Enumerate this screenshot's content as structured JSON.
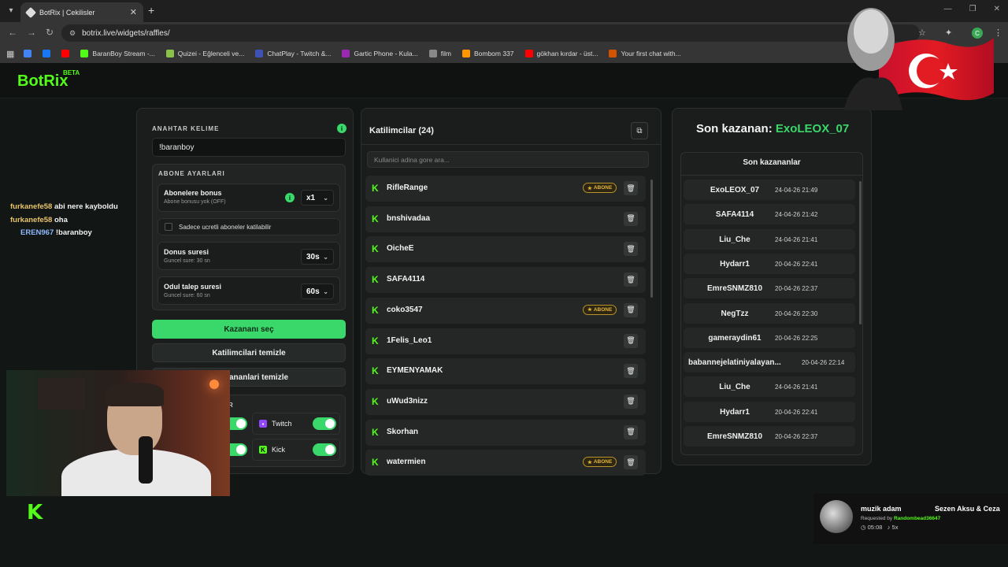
{
  "browser": {
    "tab_title": "BotRix | Cekilisler",
    "url": "botrix.live/widgets/raffles/",
    "bookmarks": [
      {
        "label": "",
        "color": "#4285f4"
      },
      {
        "label": "",
        "color": "#1877f2"
      },
      {
        "label": "",
        "color": "#ff0000"
      },
      {
        "label": "BaranBoy Stream -...",
        "color": "#53fc18"
      },
      {
        "label": "Quizei - Eğlenceli ve...",
        "color": "#8bc34a"
      },
      {
        "label": "ChatPlay - Twitch &...",
        "color": "#3f51b5"
      },
      {
        "label": "Gartic Phone - Kula...",
        "color": "#9c27b0"
      },
      {
        "label": "film",
        "color": "#888888"
      },
      {
        "label": "Bombom 337",
        "color": "#ff9800"
      },
      {
        "label": "gökhan kırdar - üst...",
        "color": "#ff0000"
      },
      {
        "label": "Your first chat with...",
        "color": "#d35400"
      }
    ]
  },
  "app": {
    "logo": "BotRix",
    "logo_tag": "BETA"
  },
  "settings": {
    "keyword_label": "ANAHTAR KELIME",
    "keyword_value": "!baranboy",
    "sub_settings_label": "ABONE AYARLARI",
    "sub_bonus_title": "Abonelere bonus",
    "sub_bonus_sub": "Abone bonusu yok (OFF)",
    "sub_bonus_value": "x1",
    "only_paid_label": "Sadece ucretli aboneler katilabilir",
    "spin_title": "Donus suresi",
    "spin_sub": "Guncel sure: 30 sn",
    "spin_value": "30s",
    "claim_title": "Odul talep suresi",
    "claim_sub": "Guncel sure: 60 sn",
    "claim_value": "60s",
    "pick_winner": "Kazananı seç",
    "clear_participants": "Katilimcilari temizle",
    "clear_winners": "ananlari temizle",
    "platforms_label": "R",
    "twitch_label": "Twitch",
    "kick_label": "Kick"
  },
  "participants": {
    "title": "Katilimcilar (24)",
    "search_placeholder": "Kullanici adina gore ara...",
    "sub_badge": "ABONE",
    "list": [
      {
        "name": "RifleRange",
        "sub": true
      },
      {
        "name": "bnshivadaa",
        "sub": false
      },
      {
        "name": "OicheE",
        "sub": false
      },
      {
        "name": "SAFA4114",
        "sub": false
      },
      {
        "name": "coko3547",
        "sub": true
      },
      {
        "name": "1Felis_Leo1",
        "sub": false
      },
      {
        "name": "EYMENYAMAK",
        "sub": false
      },
      {
        "name": "uWud3nizz",
        "sub": false
      },
      {
        "name": "Skorhan",
        "sub": false
      },
      {
        "name": "watermien",
        "sub": true
      }
    ]
  },
  "winners": {
    "last_label": "Son kazanan:",
    "last_name": "ExoLEOX_07",
    "list_title": "Son kazananlar",
    "list": [
      {
        "name": "ExoLEOX_07",
        "date": "24-04-26 21:49"
      },
      {
        "name": "SAFA4114",
        "date": "24-04-26 21:42"
      },
      {
        "name": "Liu_Che",
        "date": "24-04-26 21:41"
      },
      {
        "name": "Hydarr1",
        "date": "20-04-26 22:41"
      },
      {
        "name": "EmreSNMZ810",
        "date": "20-04-26 22:37"
      },
      {
        "name": "NegTzz",
        "date": "20-04-26 22:30"
      },
      {
        "name": "gameraydin61",
        "date": "20-04-26 22:25"
      },
      {
        "name": "babannejelatiniyalayan...",
        "date": "20-04-26 22:14"
      },
      {
        "name": "Liu_Che",
        "date": "24-04-26 21:41"
      },
      {
        "name": "Hydarr1",
        "date": "20-04-26 22:41"
      },
      {
        "name": "EmreSNMZ810",
        "date": "20-04-26 22:37"
      }
    ]
  },
  "chat": [
    {
      "user": "furkanefe58",
      "msg": "abi nere kayboldu"
    },
    {
      "user": "furkanefe58",
      "msg": "oha"
    },
    {
      "user": "EREN967",
      "msg": "!baranboy"
    }
  ],
  "music": {
    "song": "muzik adam",
    "artist": "Sezen Aksu & Ceza",
    "requested_prefix": "Requested by",
    "requested_by": "Randombead36647",
    "time": "05:08",
    "count": "5x"
  },
  "colors": {
    "accent": "#3ad76a",
    "kick": "#53fc18"
  }
}
